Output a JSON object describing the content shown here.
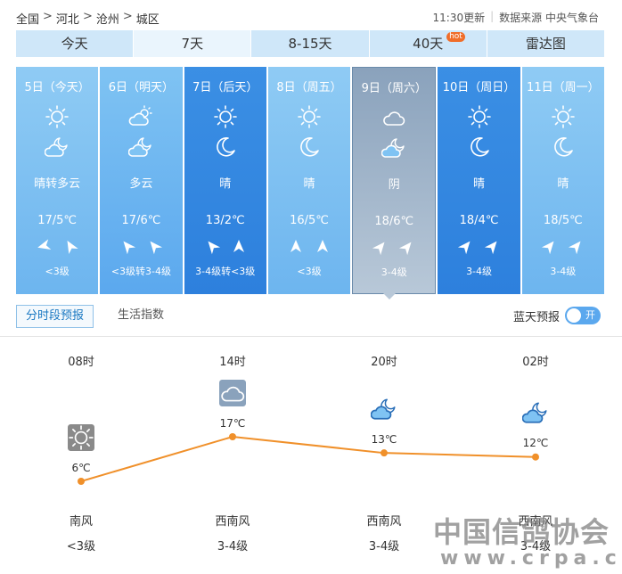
{
  "breadcrumb": [
    "全国",
    "河北",
    "沧州",
    "城区"
  ],
  "meta": {
    "updated": "11:30更新",
    "source": "数据来源 中央气象台"
  },
  "tabs": [
    {
      "label": "今天"
    },
    {
      "label": "7天"
    },
    {
      "label": "8-15天"
    },
    {
      "label": "40天",
      "badge": "hot"
    },
    {
      "label": "雷达图"
    }
  ],
  "days": [
    {
      "date": "5日（今天）",
      "day_icon": "sun-icon",
      "night_icon": "partly-cloudy-night-icon",
      "condition": "晴转多云",
      "temp": "17/5℃",
      "level": "<3级"
    },
    {
      "date": "6日（明天）",
      "day_icon": "partly-cloudy-icon",
      "night_icon": "partly-cloudy-night-icon",
      "condition": "多云",
      "temp": "17/6℃",
      "level": "<3级转3-4级"
    },
    {
      "date": "7日（后天）",
      "day_icon": "sun-icon",
      "night_icon": "moon-icon",
      "condition": "晴",
      "temp": "13/2℃",
      "level": "3-4级转<3级"
    },
    {
      "date": "8日（周五）",
      "day_icon": "sun-icon",
      "night_icon": "moon-icon",
      "condition": "晴",
      "temp": "16/5℃",
      "level": "<3级"
    },
    {
      "date": "9日（周六）",
      "day_icon": "cloudy-icon",
      "night_icon": "partly-cloudy-night-icon",
      "condition": "阴",
      "temp": "18/6℃",
      "level": "3-4级"
    },
    {
      "date": "10日（周日）",
      "day_icon": "sun-icon",
      "night_icon": "moon-icon",
      "condition": "晴",
      "temp": "18/4℃",
      "level": "3-4级"
    },
    {
      "date": "11日（周一）",
      "day_icon": "sun-icon",
      "night_icon": "moon-icon",
      "condition": "晴",
      "temp": "18/5℃",
      "level": "3-4级"
    }
  ],
  "subtabs": {
    "hourly": "分时段预报",
    "index": "生活指数"
  },
  "toggle": {
    "label": "蓝天预报",
    "state": "开"
  },
  "hourly": [
    {
      "time": "08时",
      "icon": "sun-icon",
      "temp": "6℃",
      "temp_value": 6,
      "wind": "南风",
      "level": "<3级"
    },
    {
      "time": "14时",
      "icon": "cloudy-icon",
      "temp": "17℃",
      "temp_value": 17,
      "wind": "西南风",
      "level": "3-4级"
    },
    {
      "time": "20时",
      "icon": "partly-cloudy-night-icon",
      "temp": "13℃",
      "temp_value": 13,
      "wind": "西南风",
      "level": "3-4级"
    },
    {
      "time": "02时",
      "icon": "partly-cloudy-night-icon",
      "temp": "12℃",
      "temp_value": 12,
      "wind": "西南风",
      "level": "3-4级"
    }
  ],
  "watermark": {
    "title": "中国信鸽协会",
    "url": "www.crpa.cn"
  },
  "colors": {
    "accent": "#5ba8ee",
    "line": "#f0902a"
  }
}
